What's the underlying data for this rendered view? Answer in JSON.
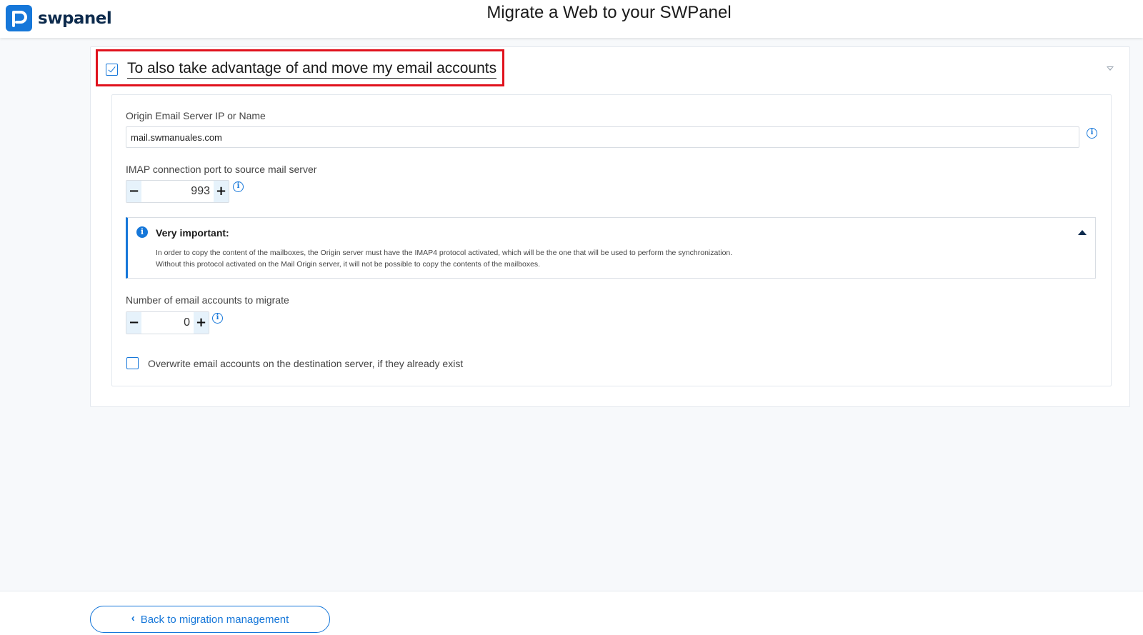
{
  "header": {
    "logo_text": "swpanel",
    "title": "Migrate a Web to your SWPanel"
  },
  "email_section": {
    "checkbox_label": "To also take advantage of and move my email accounts",
    "checked": true,
    "origin_server": {
      "label": "Origin Email Server IP or Name",
      "value": "mail.swmanuales.com"
    },
    "imap_port": {
      "label": "IMAP connection port to source mail server",
      "value": "993",
      "minus": "−",
      "plus": "+"
    },
    "alert": {
      "title": "Very important:",
      "line1": "In order to copy the content of the mailboxes, the Origin server must have the IMAP4 protocol activated, which will be the one that will be used to perform the synchronization.",
      "line2": "Without this protocol activated on the Mail Origin server, it will not be possible to copy the contents of the mailboxes."
    },
    "accounts_count": {
      "label": "Number of email accounts to migrate",
      "value": "0",
      "minus": "−",
      "plus": "+"
    },
    "overwrite": {
      "label": "Overwrite email accounts on the destination server, if they already exist",
      "checked": false
    }
  },
  "footer": {
    "back_label": "Back to migration management"
  },
  "icons": {
    "info": "i",
    "back": "‹"
  },
  "colors": {
    "accent": "#1677d9",
    "highlight": "#e0121d",
    "brand_dark": "#0d2b4d"
  }
}
